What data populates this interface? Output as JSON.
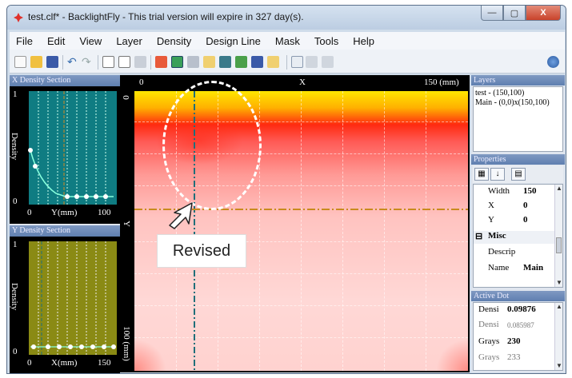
{
  "window": {
    "title": "test.clf* - BacklightFly - This trial version will expire in 327 day(s).",
    "buttons": {
      "minimize": "—",
      "maximize": "▢",
      "close": "X"
    }
  },
  "menu": [
    "File",
    "Edit",
    "View",
    "Layer",
    "Density",
    "Design Line",
    "Mask",
    "Tools",
    "Help"
  ],
  "left_panel": {
    "x_section": {
      "header": "X Density Section",
      "ylabel": "Density",
      "y_ticks": [
        "1",
        "0"
      ],
      "x_ticks": [
        "0",
        "Y(mm)",
        "100"
      ]
    },
    "y_section": {
      "header": "Y Density Section",
      "ylabel": "Density",
      "y_ticks": [
        "1",
        "0"
      ],
      "x_ticks": [
        "0",
        "X(mm)",
        "150"
      ]
    }
  },
  "canvas": {
    "top_axis": {
      "start": "0",
      "label": "X",
      "end": "150 (mm)"
    },
    "left_axis": {
      "start": "0",
      "label": "Y",
      "end": "100 (mm)"
    },
    "callout": "Revised"
  },
  "layers": {
    "header": "Layers",
    "items": [
      "test - (150,100)",
      "Main - (0,0)x(150,100)"
    ]
  },
  "properties": {
    "header": "Properties",
    "rows": [
      {
        "name": "Width",
        "value": "150"
      },
      {
        "name": "X",
        "value": "0"
      },
      {
        "name": "Y",
        "value": "0"
      },
      {
        "name": "Misc",
        "value": ""
      },
      {
        "name": "Descrip",
        "value": ""
      },
      {
        "name": "Name",
        "value": "Main"
      }
    ]
  },
  "active_dot": {
    "header": "Active Dot",
    "rows": [
      {
        "name": "Densi",
        "value": "0.09876"
      },
      {
        "name": "Densi",
        "value": "0.085987"
      },
      {
        "name": "Grays",
        "value": "230"
      },
      {
        "name": "Grays",
        "value": "233"
      }
    ]
  },
  "colors": {
    "chart_teal": "#0f7c82",
    "chart_olive": "#8a8a14",
    "accent_blue": "#5f7fb0"
  }
}
